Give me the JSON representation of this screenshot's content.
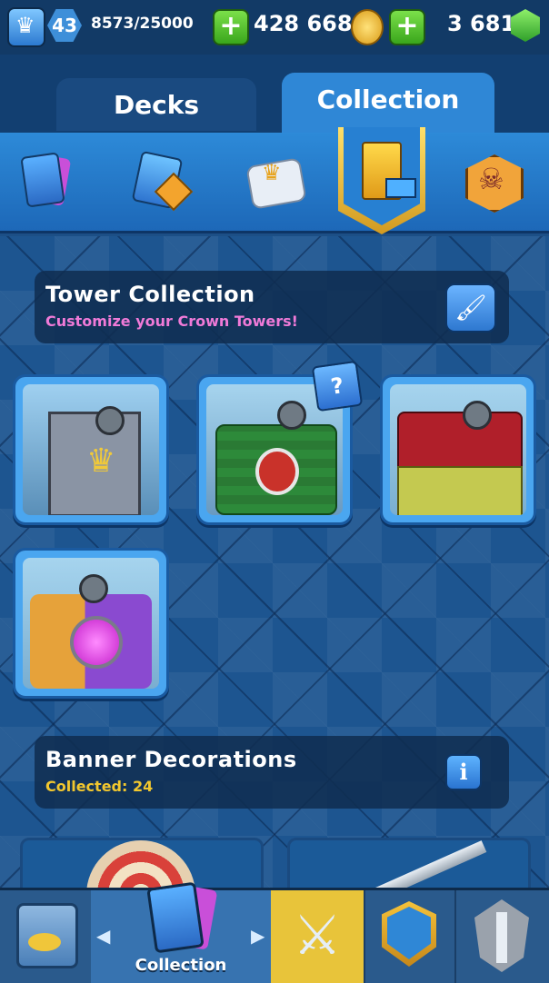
{
  "topbar": {
    "level": "43",
    "xp": "8573/25000",
    "gold": "428 668",
    "gems": "3 681",
    "plus_label": "+"
  },
  "tabs": [
    {
      "label": "Decks",
      "active": false
    },
    {
      "label": "Collection",
      "active": true
    }
  ],
  "category_icons": [
    "cards-icon",
    "magic-item-icon",
    "emote-icon",
    "tower-icon",
    "banner-skull-icon"
  ],
  "tower_section": {
    "title": "Tower Collection",
    "subtitle": "Customize your Crown Towers!",
    "subtitle_color": "#f07ad8"
  },
  "towers": [
    {
      "name": "default-tower"
    },
    {
      "name": "ugly-sweater-tower",
      "mystery_badge": "?"
    },
    {
      "name": "holiday-tower"
    },
    {
      "name": "gem-tower"
    }
  ],
  "banner_section": {
    "title": "Banner Decorations",
    "subtitle": "Collected: 24",
    "subtitle_color": "#f2c72e",
    "info_label": "i"
  },
  "nav": {
    "active_label": "Collection",
    "items": [
      "shop",
      "collection",
      "battle",
      "clan",
      "events"
    ]
  },
  "colors": {
    "accent_blue": "#2f87d6",
    "battle_yellow": "#e8c43a",
    "gem_green": "#2f9f2a"
  }
}
